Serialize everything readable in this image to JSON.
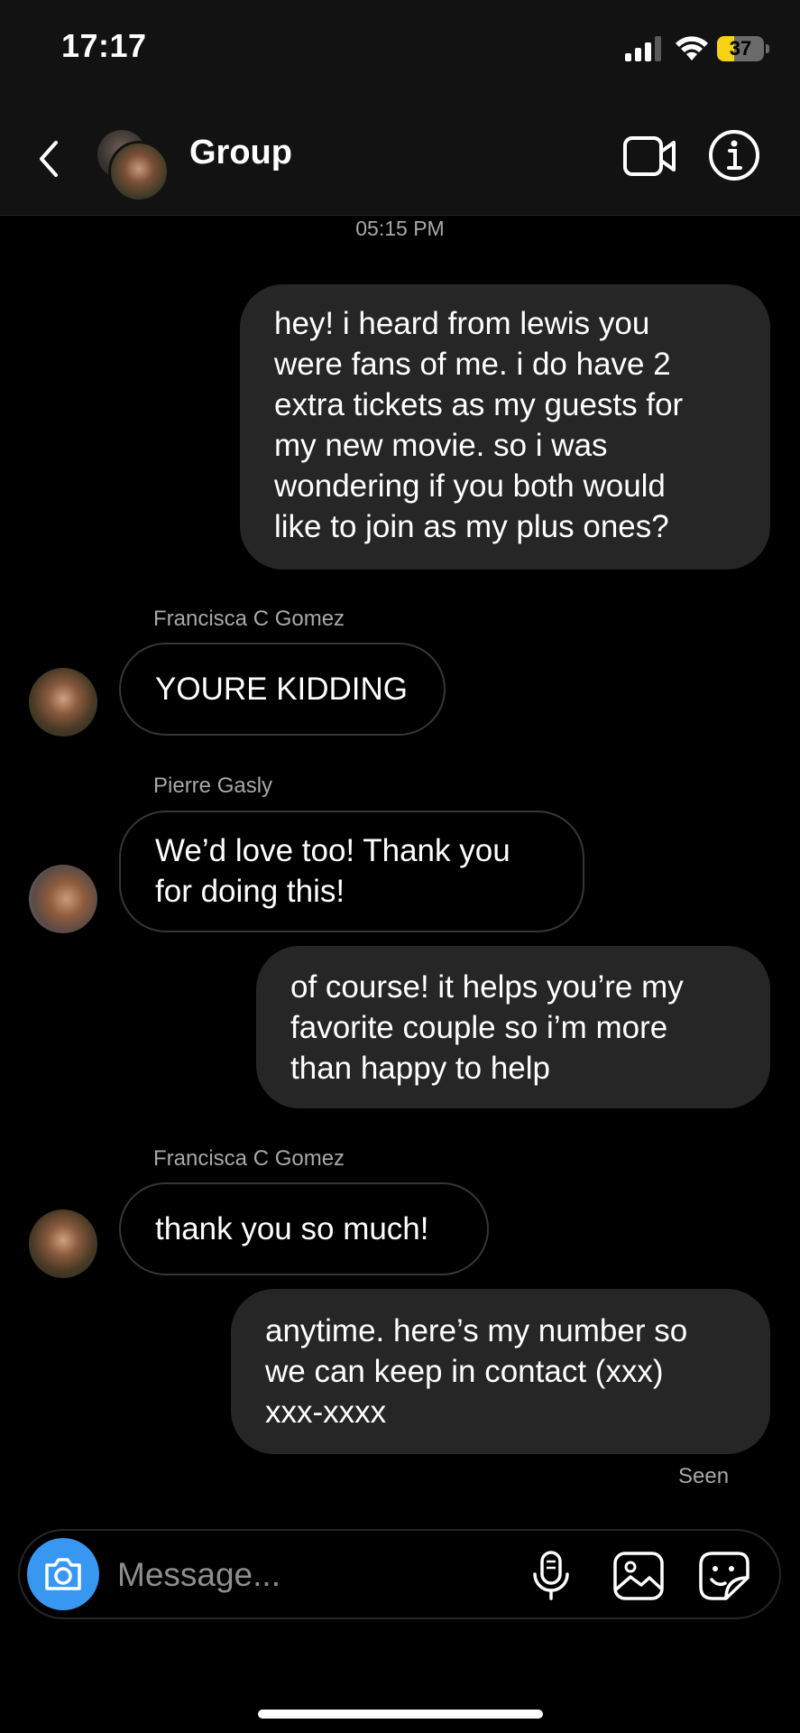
{
  "status_bar": {
    "time": "17:17",
    "battery_level": "37",
    "battery_fraction": 0.37
  },
  "header": {
    "title": "Group"
  },
  "conversation": {
    "timestamp": "05:15 PM",
    "messages": [
      {
        "direction": "out",
        "lines": [
          "hey! i heard from lewis you",
          "were fans of me. i do have 2",
          "extra tickets as my guests for",
          "my new movie. so i was",
          "wondering if you both would",
          "like to join as my plus ones?"
        ]
      },
      {
        "direction": "in",
        "sender": "Francisca C Gomez",
        "lines": [
          "YOURE KIDDING"
        ]
      },
      {
        "direction": "in",
        "sender": "Pierre Gasly",
        "lines": [
          "We’d love too! Thank you",
          "for doing this!"
        ]
      },
      {
        "direction": "out",
        "lines": [
          "of course! it helps you’re my",
          "favorite couple so i’m more",
          "than happy to help"
        ]
      },
      {
        "direction": "in",
        "sender": "Francisca C Gomez",
        "lines": [
          "thank you so much!"
        ]
      },
      {
        "direction": "out",
        "lines": [
          "anytime. here’s my number so",
          "we can keep in contact (xxx)",
          "xxx-xxxx"
        ]
      }
    ],
    "seen_label": "Seen"
  },
  "composer": {
    "placeholder": "Message...",
    "accent_color": "#3897f0"
  },
  "icons": [
    "back-arrow-icon",
    "video-call-icon",
    "info-icon",
    "camera-icon",
    "microphone-icon",
    "gallery-icon",
    "sticker-icon",
    "signal-icon",
    "wifi-icon",
    "battery-icon"
  ]
}
